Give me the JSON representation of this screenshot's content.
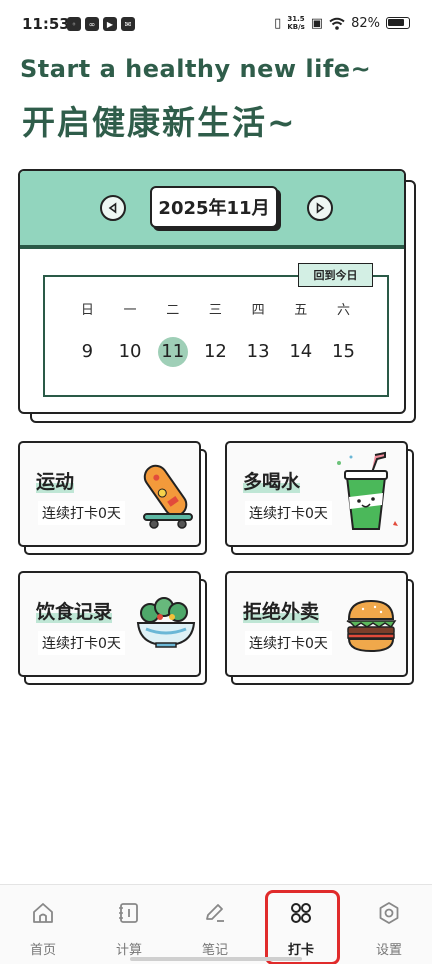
{
  "status_bar": {
    "time": "11:53",
    "net_speed_value": "31.5",
    "net_speed_unit": "KB/s",
    "battery": "82%"
  },
  "header": {
    "title_en": "Start a healthy new life~",
    "title_cn": "开启健康新生活~"
  },
  "calendar": {
    "month_label": "2025年11月",
    "today_button": "回到今日",
    "weekdays": [
      "日",
      "一",
      "二",
      "三",
      "四",
      "五",
      "六"
    ],
    "dates": [
      "9",
      "10",
      "11",
      "12",
      "13",
      "14",
      "15"
    ],
    "selected_date": "11",
    "accent_color": "#92d5be",
    "dark_green": "#2a5a47"
  },
  "habits": [
    {
      "title": "运动",
      "subtitle": "连续打卡0天",
      "icon": "skateboard-icon"
    },
    {
      "title": "多喝水",
      "subtitle": "连续打卡0天",
      "icon": "drink-cup-icon"
    },
    {
      "title": "饮食记录",
      "subtitle": "连续打卡0天",
      "icon": "salad-bowl-icon"
    },
    {
      "title": "拒绝外卖",
      "subtitle": "连续打卡0天",
      "icon": "burger-icon"
    }
  ],
  "bottom_nav": {
    "items": [
      {
        "label": "首页",
        "icon": "home-icon"
      },
      {
        "label": "计算",
        "icon": "calculator-icon"
      },
      {
        "label": "笔记",
        "icon": "pen-icon"
      },
      {
        "label": "打卡",
        "icon": "four-circles-icon"
      },
      {
        "label": "设置",
        "icon": "settings-icon"
      }
    ],
    "active_index": 3,
    "highlight_color": "#e02b2b"
  }
}
